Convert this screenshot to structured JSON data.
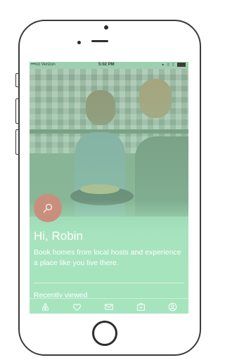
{
  "status_bar": {
    "carrier": "•••oo Verizon",
    "time": "5:02 PM"
  },
  "home": {
    "greeting": "Hi, Robin",
    "tagline": "Book homes from local hosts and experience a place like you live there.",
    "recently_viewed_label": "Recently viewed"
  },
  "tabbar": {
    "items": [
      {
        "icon": "airbnb-logo-icon"
      },
      {
        "icon": "heart-icon"
      },
      {
        "icon": "envelope-icon"
      },
      {
        "icon": "trips-icon"
      },
      {
        "icon": "profile-icon"
      }
    ]
  },
  "colors": {
    "overlay_green": "#a6e4be",
    "search_button": "#c98f7c",
    "text": "#ffffff"
  }
}
